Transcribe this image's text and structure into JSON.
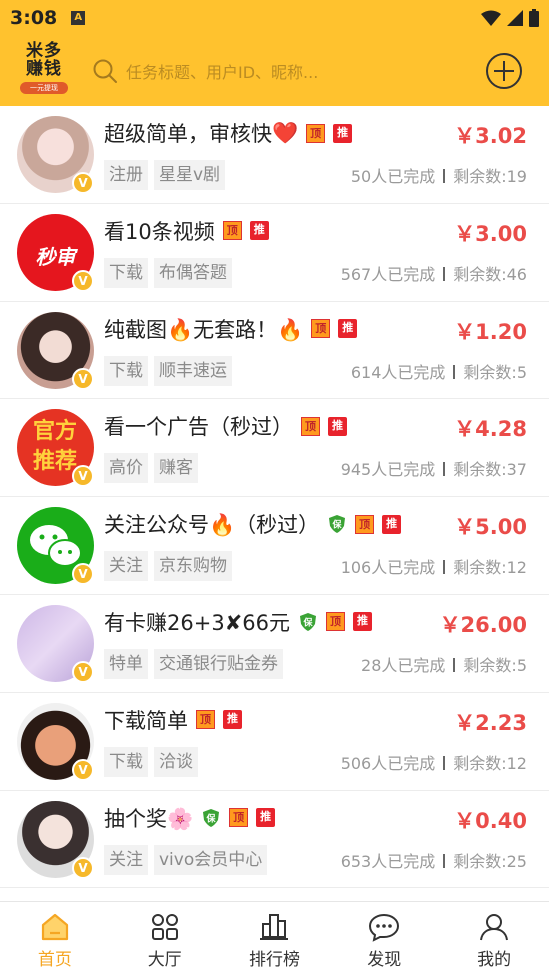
{
  "status": {
    "time": "3:08",
    "notif": "A"
  },
  "header": {
    "logo_line1": "米多",
    "logo_line2": "赚钱",
    "logo_sub": "一元提现",
    "search_placeholder": "任务标题、用户ID、昵称..."
  },
  "tasks": [
    {
      "title": "超级简单，审核快",
      "emoji": "❤️",
      "tags": [
        "顶",
        "推"
      ],
      "price": "￥3.02",
      "chip1": "注册",
      "chip2": "星星v剧",
      "done": "50人已完成",
      "remain": "剩余数:19",
      "avatar": "girl-pink"
    },
    {
      "title": "看10条视频",
      "emoji": "",
      "tags": [
        "顶",
        "推"
      ],
      "price": "￥3.00",
      "chip1": "下载",
      "chip2": "布偶答题",
      "done": "567人已完成",
      "remain": "剩余数:46",
      "avatar": "miaoshen",
      "avatar_text": "秒审"
    },
    {
      "title": "纯截图🔥无套路！🔥",
      "emoji": "",
      "tags": [
        "顶",
        "推"
      ],
      "price": "￥1.20",
      "chip1": "下载",
      "chip2": "顺丰速运",
      "done": "614人已完成",
      "remain": "剩余数:5",
      "avatar": "girl-dark"
    },
    {
      "title": "看一个广告（秒过）",
      "emoji": "",
      "tags": [
        "顶",
        "推"
      ],
      "price": "￥4.28",
      "chip1": "高价",
      "chip2": "赚客",
      "done": "945人已完成",
      "remain": "剩余数:37",
      "avatar": "guanfang",
      "avatar_text": "官方推荐"
    },
    {
      "title": "关注公众号🔥（秒过）",
      "emoji": "",
      "tags": [
        "保",
        "顶",
        "推"
      ],
      "price": "￥5.00",
      "chip1": "关注",
      "chip2": "京东购物",
      "done": "106人已完成",
      "remain": "剩余数:12",
      "avatar": "wechat"
    },
    {
      "title": "有卡赚26+3✘66元",
      "emoji": "",
      "tags": [
        "保",
        "顶",
        "推"
      ],
      "price": "￥26.00",
      "chip1": "特单",
      "chip2": "交通银行贴金券",
      "done": "28人已完成",
      "remain": "剩余数:5",
      "avatar": "card"
    },
    {
      "title": "下载简单",
      "emoji": "",
      "tags": [
        "顶",
        "推"
      ],
      "price": "￥2.23",
      "chip1": "下载",
      "chip2": "洽谈",
      "done": "506人已完成",
      "remain": "剩余数:12",
      "avatar": "cartoon"
    },
    {
      "title": "抽个奖🌸",
      "emoji": "",
      "tags": [
        "保",
        "顶",
        "推"
      ],
      "price": "￥0.40",
      "chip1": "关注",
      "chip2": "vivo会员中心",
      "done": "653人已完成",
      "remain": "剩余数:25",
      "avatar": "girl-scarf"
    }
  ],
  "tabs": [
    {
      "label": "首页",
      "icon": "home-icon",
      "active": true
    },
    {
      "label": "大厅",
      "icon": "grid-icon",
      "active": false
    },
    {
      "label": "排行榜",
      "icon": "ranking-icon",
      "active": false
    },
    {
      "label": "发现",
      "icon": "chat-icon",
      "active": false
    },
    {
      "label": "我的",
      "icon": "user-icon",
      "active": false
    }
  ],
  "colors": {
    "brand": "#ffc22e",
    "price": "#ea4c49",
    "active_tab": "#f5a623"
  }
}
